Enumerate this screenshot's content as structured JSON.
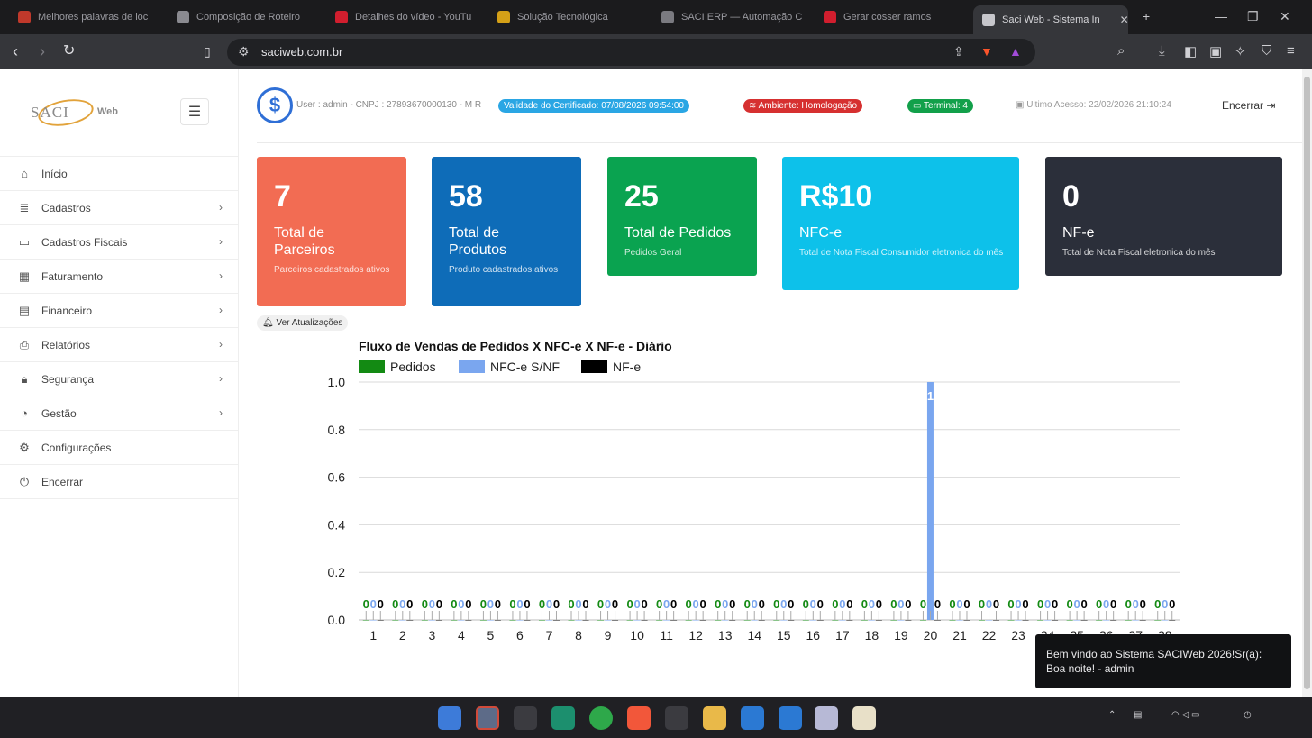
{
  "browser": {
    "tabs": [
      {
        "label": "Melhores palavras de loc",
        "color": "#c0392b"
      },
      {
        "label": "Composição de Roteiro",
        "color": "#8a8a90"
      },
      {
        "label": "Detalhes do vídeo - YouTu",
        "color": "#d11e2e"
      },
      {
        "label": "Solução Tecnológica",
        "color": "#d4a017"
      },
      {
        "label": "SACI ERP — Automação C",
        "color": "#7a7a80"
      },
      {
        "label": "Gerar cosser ramos",
        "color": "#d11e2e"
      },
      {
        "label": "Saci Web - Sistema In",
        "color": "#c7c7cc",
        "active": true
      }
    ],
    "url": "saciweb.com.br"
  },
  "sidebar": {
    "logo_text": "SACI",
    "logo_web": "Web",
    "items": [
      {
        "label": "Início",
        "icon": "home-icon",
        "glyph": "⌂",
        "chevron": false
      },
      {
        "label": "Cadastros",
        "icon": "list-icon",
        "glyph": "≣",
        "chevron": true
      },
      {
        "label": "Cadastros Fiscais",
        "icon": "desktop-icon",
        "glyph": "▭",
        "chevron": true
      },
      {
        "label": "Faturamento",
        "icon": "grid-icon",
        "glyph": "▦",
        "chevron": true
      },
      {
        "label": "Financeiro",
        "icon": "archive-icon",
        "glyph": "▤",
        "chevron": true
      },
      {
        "label": "Relatórios",
        "icon": "print-icon",
        "glyph": "⎙",
        "chevron": true
      },
      {
        "label": "Segurança",
        "icon": "lock-icon",
        "glyph": "🔒︎",
        "chevron": true
      },
      {
        "label": "Gestão",
        "icon": "pie-chart-icon",
        "glyph": "◔",
        "chevron": true
      },
      {
        "label": "Configurações",
        "icon": "cogs-icon",
        "glyph": "⚙",
        "chevron": false
      },
      {
        "label": "Encerrar",
        "icon": "power-icon",
        "glyph": "⏻",
        "chevron": false
      }
    ]
  },
  "header": {
    "user_info": "User : admin - CNPJ : 27893670000130 - M R",
    "cert": "Validade do Certificado: 07/08/2026 09:54:00",
    "ambiente": "Ambiente: Homologação",
    "terminal": "Terminal: 4",
    "last_access": "Ultimo Acesso: 22/02/2026 21:10:24",
    "logout": "Encerrar"
  },
  "cards": [
    {
      "value": "7",
      "title": "Total de Parceiros",
      "subtitle": "Parceiros cadastrados ativos",
      "color": "#f26c53"
    },
    {
      "value": "58",
      "title": "Total de Produtos",
      "subtitle": "Produto cadastrados ativos",
      "color": "#0e6cb8"
    },
    {
      "value": "25",
      "title": "Total de Pedidos",
      "subtitle": "Pedidos Geral",
      "color": "#0aa350"
    },
    {
      "value": "R$10",
      "title": "NFC-e",
      "subtitle": "Total de Nota Fiscal Consumidor eletronica do mês",
      "color": "#0dc1ea"
    },
    {
      "value": "0",
      "title": "NF-e",
      "subtitle": "Total de Nota Fiscal eletronica do mês",
      "color": "#2b2f3a"
    }
  ],
  "updates_button": "Ver Atualizações",
  "chart_data": {
    "type": "bar",
    "title": "Fluxo de Vendas de Pedidos X NFC-e X NF-e - Diário",
    "categories": [
      "1",
      "2",
      "3",
      "4",
      "5",
      "6",
      "7",
      "8",
      "9",
      "10",
      "11",
      "12",
      "13",
      "14",
      "15",
      "16",
      "17",
      "18",
      "19",
      "20",
      "21",
      "22",
      "23",
      "24",
      "25",
      "26",
      "27",
      "28"
    ],
    "series": [
      {
        "name": "Pedidos",
        "color": "#138a13",
        "values": [
          0,
          0,
          0,
          0,
          0,
          0,
          0,
          0,
          0,
          0,
          0,
          0,
          0,
          0,
          0,
          0,
          0,
          0,
          0,
          0,
          0,
          0,
          0,
          0,
          0,
          0,
          0,
          0
        ]
      },
      {
        "name": "NFC-e S/NF",
        "color": "#7aa6ef",
        "values": [
          0,
          0,
          0,
          0,
          0,
          0,
          0,
          0,
          0,
          0,
          0,
          0,
          0,
          0,
          0,
          0,
          0,
          0,
          0,
          1,
          0,
          0,
          0,
          0,
          0,
          0,
          0,
          0
        ]
      },
      {
        "name": "NF-e",
        "color": "#000000",
        "values": [
          0,
          0,
          0,
          0,
          0,
          0,
          0,
          0,
          0,
          0,
          0,
          0,
          0,
          0,
          0,
          0,
          0,
          0,
          0,
          0,
          0,
          0,
          0,
          0,
          0,
          0,
          0,
          0
        ]
      }
    ],
    "yticks": [
      "0.0",
      "0.2",
      "0.4",
      "0.6",
      "0.8",
      "1.0"
    ],
    "ylim": [
      0,
      1
    ],
    "grid": true,
    "legend": "top-left"
  },
  "toast": {
    "message": "Bem vindo ao Sistema SACIWeb 2026!Sr(a): Boa noite! - admin"
  }
}
